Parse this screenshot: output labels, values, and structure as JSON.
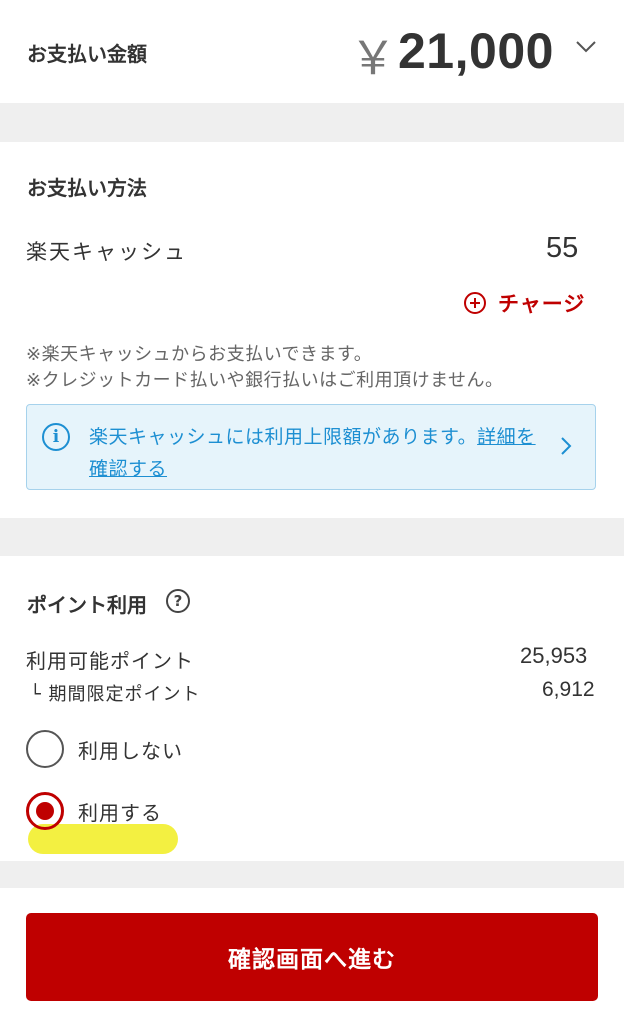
{
  "amount": {
    "label": "お支払い金額",
    "currency_symbol": "￥",
    "value": "21,000"
  },
  "method": {
    "title": "お支払い方法",
    "name": "楽天キャッシュ",
    "balance": "55",
    "charge_label": "チャージ",
    "note1": "※楽天キャッシュからお支払いできます。",
    "note2": "※クレジットカード払いや銀行払いはご利用頂けません。",
    "info_text": "楽天キャッシュには利用上限額があります。",
    "info_link": "詳細を確認する",
    "info_icon": "i"
  },
  "points": {
    "title": "ポイント利用",
    "help_icon": "?",
    "available_label": "利用可能ポイント",
    "available_value": "25,953",
    "limited_label": "└ 期間限定ポイント",
    "limited_value": "6,912",
    "options": [
      {
        "label": "利用しない",
        "selected": false
      },
      {
        "label": "利用する",
        "selected": true
      }
    ]
  },
  "footer": {
    "confirm_label": "確認画面へ進む"
  },
  "colors": {
    "accent": "#bf0000",
    "info": "#1d8fd2",
    "info_bg": "#e6f4fb",
    "highlight": "#f2ef37"
  }
}
